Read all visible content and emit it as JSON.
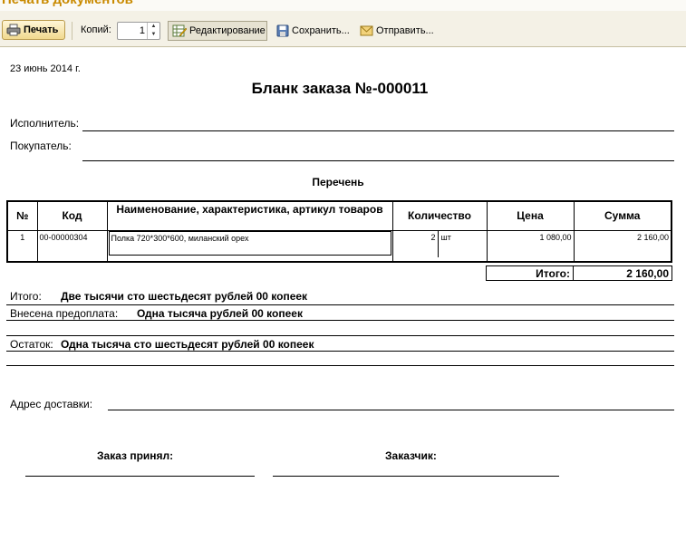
{
  "window": {
    "title": "Печать документов"
  },
  "toolbar": {
    "print_label": "Печать",
    "copies_label": "Копий:",
    "copies_value": "1",
    "edit_label": "Редактирование",
    "save_label": "Сохранить...",
    "send_label": "Отправить..."
  },
  "document": {
    "date": "23 июнь 2014 г.",
    "title": "Бланк заказа №-000011",
    "executor_label": "Исполнитель:",
    "buyer_label": "Покупатель:",
    "list_title": "Перечень",
    "table": {
      "headers": {
        "num": "№",
        "code": "Код",
        "name": "Наименование, характеристика, артикул товаров",
        "qty": "Количество",
        "price": "Цена",
        "sum": "Сумма"
      },
      "rows": [
        {
          "num": "1",
          "code": "00-00000304",
          "name": "Полка 720*300*600, миланский орех",
          "qty": "2",
          "unit": "шт",
          "price": "1 080,00",
          "sum": "2 160,00"
        }
      ]
    },
    "total_label": "Итого:",
    "total_value": "2 160,00",
    "total_words_label": "Итого:",
    "total_words": "Две тысячи сто шестьдесят рублей 00 копеек",
    "prepaid_label": "Внесена предоплата:",
    "prepaid_words": "Одна тысяча рублей 00 копеек",
    "balance_label": "Остаток:",
    "balance_words": "Одна тысяча сто шестьдесят рублей 00 копеек",
    "delivery_label": "Адрес доставки:",
    "accepted_label": "Заказ принял:",
    "customer_label": "Заказчик:"
  }
}
